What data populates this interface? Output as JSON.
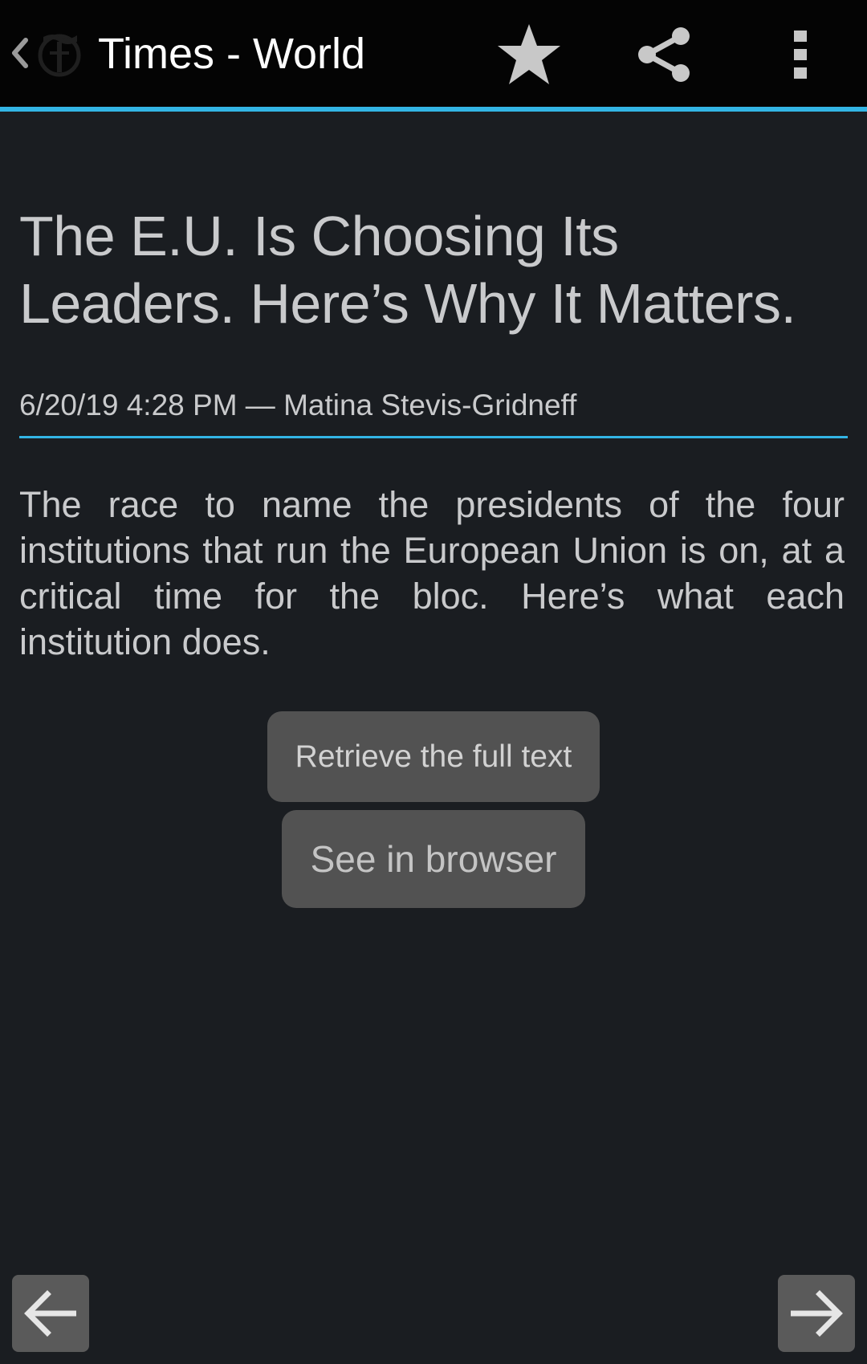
{
  "actionbar": {
    "title": "Times - World",
    "up_icon": "chevron-left-icon",
    "logo_icon": "times-logo-icon",
    "actions": [
      {
        "name": "star",
        "icon": "star-icon"
      },
      {
        "name": "share",
        "icon": "share-icon"
      },
      {
        "name": "overflow",
        "icon": "overflow-menu-icon"
      }
    ],
    "accent_color": "#33b5e5",
    "background_color": "#040404"
  },
  "article": {
    "title": "The E.U. Is Choosing Its Leaders. Here’s Why It Matters.",
    "meta": "6/20/19 4:28 PM — Matina Stevis-Gridneff",
    "summary": "The race to name the presidents of the four institutions that run the European Union is on, at a critical time for the bloc. Here’s what each institution does."
  },
  "buttons": {
    "full_text": "Retrieve the full text",
    "browser": "See in browser"
  },
  "navigation": {
    "prev_icon": "arrow-left-icon",
    "next_icon": "arrow-right-icon"
  },
  "colors": {
    "background": "#1a1d21",
    "text": "#c9cacc",
    "button": "#525252"
  }
}
